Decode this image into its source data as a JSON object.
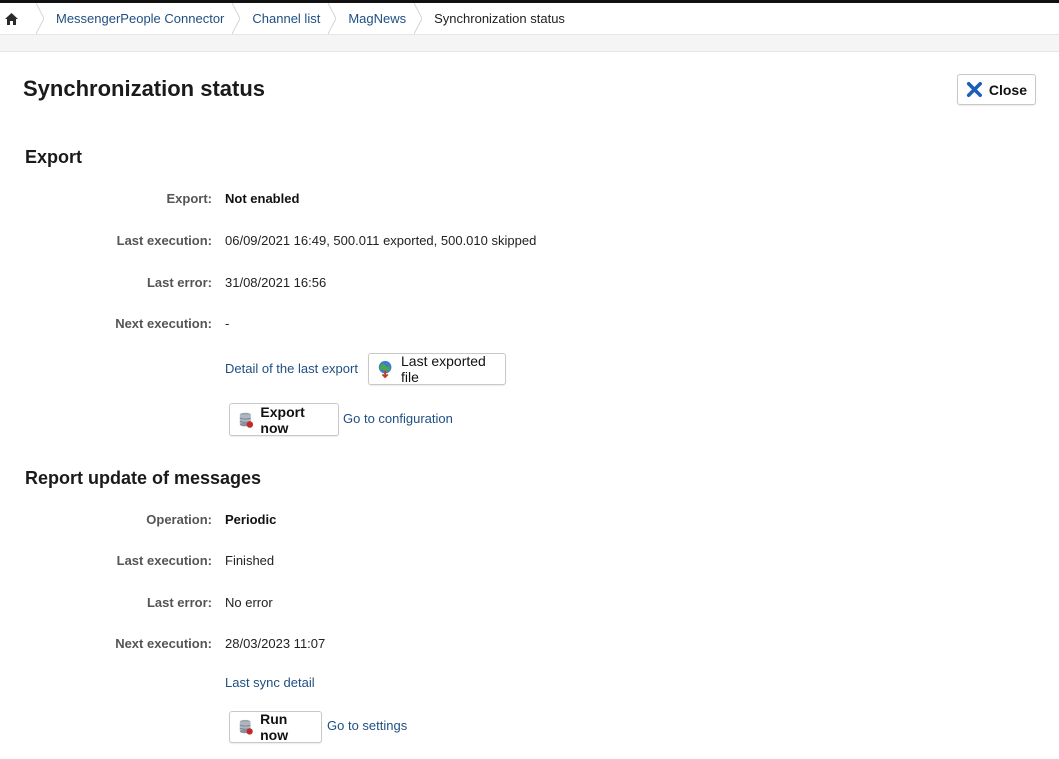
{
  "breadcrumb": {
    "items": [
      "MessengerPeople Connector",
      "Channel list",
      "MagNews"
    ],
    "current": "Synchronization status"
  },
  "page": {
    "title": "Synchronization status",
    "close_label": "Close"
  },
  "export": {
    "title": "Export",
    "rows": [
      {
        "label": "Export:",
        "value": "Not enabled"
      },
      {
        "label": "Last execution:",
        "value": "06/09/2021 16:49, 500.011 exported, 500.010 skipped"
      },
      {
        "label": "Last error:",
        "value": "31/08/2021 16:56"
      },
      {
        "label": "Next execution:",
        "value": "-"
      }
    ],
    "detail_link": "Detail of the last export",
    "file_button": "Last exported file",
    "action_button": "Export now",
    "config_link": "Go to configuration"
  },
  "report": {
    "title": "Report update of messages",
    "rows": [
      {
        "label": "Operation:",
        "value": "Periodic"
      },
      {
        "label": "Last execution:",
        "value": "Finished"
      },
      {
        "label": "Last error:",
        "value": "No error"
      },
      {
        "label": "Next execution:",
        "value": "28/03/2023 11:07"
      }
    ],
    "detail_link": "Last sync detail",
    "action_button": "Run now",
    "settings_link": "Go to settings"
  },
  "colors": {
    "link": "#1f4f82",
    "close_icon": "#1d5fb8"
  }
}
